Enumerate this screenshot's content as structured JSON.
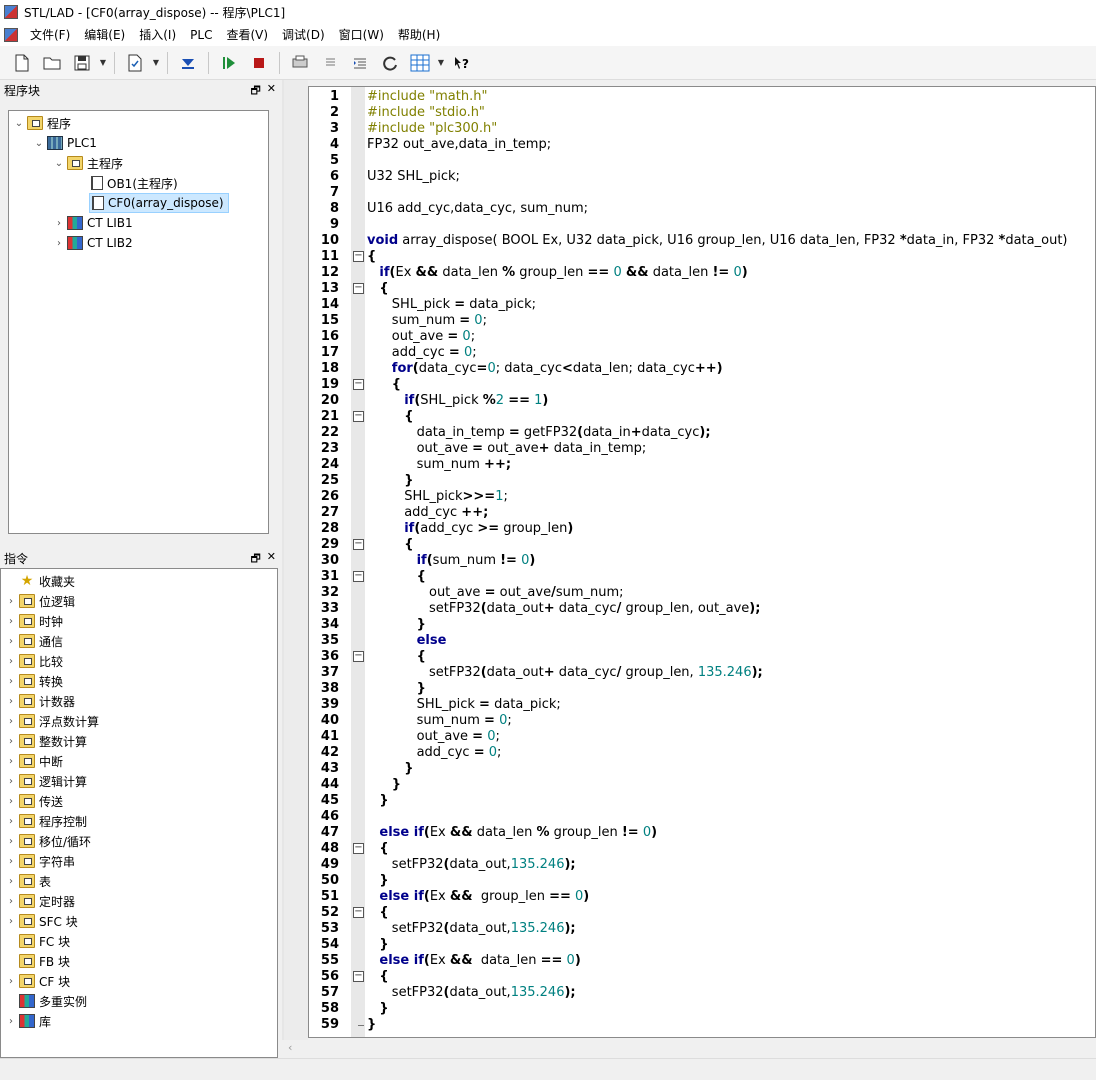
{
  "window": {
    "title": "STL/LAD - [CF0(array_dispose) -- 程序\\PLC1]"
  },
  "menu": [
    "文件(F)",
    "编辑(E)",
    "插入(I)",
    "PLC",
    "查看(V)",
    "调试(D)",
    "窗口(W)",
    "帮助(H)"
  ],
  "toolbar": {
    "icons": [
      "new-file-icon",
      "open-folder-icon",
      "save-icon",
      "save-dropdown",
      "compile-icon",
      "compile-dropdown",
      "download-icon",
      "run-icon",
      "stop-icon",
      "print-icon",
      "list-icon",
      "indent-icon",
      "refresh-icon",
      "grid-icon",
      "grid-dropdown",
      "context-help-icon"
    ]
  },
  "project_panel": {
    "title": "程序块",
    "tree": [
      {
        "label": "程序",
        "level": 0,
        "expanded": true,
        "icon": "folder-icon"
      },
      {
        "label": "PLC1",
        "level": 1,
        "expanded": true,
        "icon": "cpu-icon"
      },
      {
        "label": "主程序",
        "level": 2,
        "expanded": true,
        "icon": "folder-icon"
      },
      {
        "label": "OB1(主程序)",
        "level": 3,
        "icon": "block-icon"
      },
      {
        "label": "CF0(array_dispose)",
        "level": 3,
        "icon": "block-icon",
        "selected": true
      },
      {
        "label": "CT LIB1",
        "level": 1,
        "expanded": false,
        "icon": "library-icon"
      },
      {
        "label": "CT LIB2",
        "level": 1,
        "expanded": false,
        "icon": "library-icon"
      }
    ]
  },
  "instruction_panel": {
    "title": "指令",
    "items": [
      {
        "label": "收藏夹",
        "icon": "star-icon",
        "expandable": false
      },
      {
        "label": "位逻辑",
        "icon": "folder-icon",
        "expandable": true
      },
      {
        "label": "时钟",
        "icon": "folder-icon",
        "expandable": true
      },
      {
        "label": "通信",
        "icon": "folder-icon",
        "expandable": true
      },
      {
        "label": "比较",
        "icon": "folder-icon",
        "expandable": true
      },
      {
        "label": "转换",
        "icon": "folder-icon",
        "expandable": true
      },
      {
        "label": "计数器",
        "icon": "folder-icon",
        "expandable": true
      },
      {
        "label": "浮点数计算",
        "icon": "folder-icon",
        "expandable": true
      },
      {
        "label": "整数计算",
        "icon": "folder-icon",
        "expandable": true
      },
      {
        "label": "中断",
        "icon": "folder-icon",
        "expandable": true
      },
      {
        "label": "逻辑计算",
        "icon": "folder-icon",
        "expandable": true
      },
      {
        "label": "传送",
        "icon": "folder-icon",
        "expandable": true
      },
      {
        "label": "程序控制",
        "icon": "folder-icon",
        "expandable": true
      },
      {
        "label": "移位/循环",
        "icon": "folder-icon",
        "expandable": true
      },
      {
        "label": "字符串",
        "icon": "folder-icon",
        "expandable": true
      },
      {
        "label": "表",
        "icon": "folder-icon",
        "expandable": true
      },
      {
        "label": "定时器",
        "icon": "folder-icon",
        "expandable": true
      },
      {
        "label": "SFC 块",
        "icon": "block-folder-icon",
        "expandable": true
      },
      {
        "label": "FC 块",
        "icon": "block-folder-icon",
        "expandable": false
      },
      {
        "label": "FB 块",
        "icon": "block-folder-icon",
        "expandable": false
      },
      {
        "label": "CF 块",
        "icon": "block-folder-icon",
        "expandable": true
      },
      {
        "label": "多重实例",
        "icon": "library-icon",
        "expandable": false
      },
      {
        "label": "库",
        "icon": "library-icon",
        "expandable": true
      }
    ]
  },
  "editor": {
    "fold_markers": [
      11,
      13,
      19,
      21,
      29,
      31,
      36,
      48,
      52,
      56
    ],
    "lines": [
      [
        [
          "pp",
          "#include \"math.h\""
        ]
      ],
      [
        [
          "pp",
          "#include \"stdio.h\""
        ]
      ],
      [
        [
          "pp",
          "#include \"plc300.h\""
        ]
      ],
      [
        [
          "t",
          "FP32 out_ave,data_in_temp;"
        ]
      ],
      [
        [
          "t",
          ""
        ]
      ],
      [
        [
          "t",
          "U32 SHL_pick;"
        ]
      ],
      [
        [
          "t",
          ""
        ]
      ],
      [
        [
          "t",
          "U16 add_cyc,data_cyc, sum_num;"
        ]
      ],
      [
        [
          "t",
          ""
        ]
      ],
      [
        [
          "kw",
          "void"
        ],
        [
          "t",
          " array_dispose( BOOL Ex, U32 data_pick, U16 group_len, U16 data_len, FP32 "
        ],
        [
          "op",
          "*"
        ],
        [
          "t",
          "data_in, FP32 "
        ],
        [
          "op",
          "*"
        ],
        [
          "t",
          "data_out)"
        ]
      ],
      [
        [
          "op",
          "{"
        ]
      ],
      [
        [
          "t",
          "   "
        ],
        [
          "kw",
          "if"
        ],
        [
          "op",
          "("
        ],
        [
          "t",
          "Ex "
        ],
        [
          "op",
          "&&"
        ],
        [
          "t",
          " data_len "
        ],
        [
          "op",
          "%"
        ],
        [
          "t",
          " group_len "
        ],
        [
          "op",
          "=="
        ],
        [
          "t",
          " "
        ],
        [
          "num",
          "0"
        ],
        [
          "t",
          " "
        ],
        [
          "op",
          "&&"
        ],
        [
          "t",
          " data_len "
        ],
        [
          "op",
          "!="
        ],
        [
          "t",
          " "
        ],
        [
          "num",
          "0"
        ],
        [
          "op",
          ")"
        ]
      ],
      [
        [
          "t",
          "   "
        ],
        [
          "op",
          "{"
        ]
      ],
      [
        [
          "t",
          "      SHL_pick "
        ],
        [
          "op",
          "="
        ],
        [
          "t",
          " data_pick;"
        ]
      ],
      [
        [
          "t",
          "      sum_num "
        ],
        [
          "op",
          "="
        ],
        [
          "t",
          " "
        ],
        [
          "num",
          "0"
        ],
        [
          "t",
          ";"
        ]
      ],
      [
        [
          "t",
          "      out_ave "
        ],
        [
          "op",
          "="
        ],
        [
          "t",
          " "
        ],
        [
          "num",
          "0"
        ],
        [
          "t",
          ";"
        ]
      ],
      [
        [
          "t",
          "      add_cyc "
        ],
        [
          "op",
          "="
        ],
        [
          "t",
          " "
        ],
        [
          "num",
          "0"
        ],
        [
          "t",
          ";"
        ]
      ],
      [
        [
          "t",
          "      "
        ],
        [
          "kw",
          "for"
        ],
        [
          "op",
          "("
        ],
        [
          "t",
          "data_cyc"
        ],
        [
          "op",
          "="
        ],
        [
          "num",
          "0"
        ],
        [
          "t",
          "; data_cyc"
        ],
        [
          "op",
          "<"
        ],
        [
          "t",
          "data_len; data_cyc"
        ],
        [
          "op",
          "++)"
        ]
      ],
      [
        [
          "t",
          "      "
        ],
        [
          "op",
          "{"
        ]
      ],
      [
        [
          "t",
          "         "
        ],
        [
          "kw",
          "if"
        ],
        [
          "op",
          "("
        ],
        [
          "t",
          "SHL_pick "
        ],
        [
          "op",
          "%"
        ],
        [
          "num",
          "2"
        ],
        [
          "t",
          " "
        ],
        [
          "op",
          "=="
        ],
        [
          "t",
          " "
        ],
        [
          "num",
          "1"
        ],
        [
          "op",
          ")"
        ]
      ],
      [
        [
          "t",
          "         "
        ],
        [
          "op",
          "{"
        ]
      ],
      [
        [
          "t",
          "            data_in_temp "
        ],
        [
          "op",
          "="
        ],
        [
          "t",
          " getFP32"
        ],
        [
          "op",
          "("
        ],
        [
          "t",
          "data_in"
        ],
        [
          "op",
          "+"
        ],
        [
          "t",
          "data_cyc"
        ],
        [
          "op",
          ");"
        ]
      ],
      [
        [
          "t",
          "            out_ave "
        ],
        [
          "op",
          "="
        ],
        [
          "t",
          " out_ave"
        ],
        [
          "op",
          "+"
        ],
        [
          "t",
          " data_in_temp;"
        ]
      ],
      [
        [
          "t",
          "            sum_num "
        ],
        [
          "op",
          "++;"
        ]
      ],
      [
        [
          "t",
          "         "
        ],
        [
          "op",
          "}"
        ]
      ],
      [
        [
          "t",
          "         SHL_pick"
        ],
        [
          "op",
          ">>="
        ],
        [
          "num",
          "1"
        ],
        [
          "t",
          ";"
        ]
      ],
      [
        [
          "t",
          "         add_cyc "
        ],
        [
          "op",
          "++;"
        ]
      ],
      [
        [
          "t",
          "         "
        ],
        [
          "kw",
          "if"
        ],
        [
          "op",
          "("
        ],
        [
          "t",
          "add_cyc "
        ],
        [
          "op",
          ">="
        ],
        [
          "t",
          " group_len"
        ],
        [
          "op",
          ")"
        ]
      ],
      [
        [
          "t",
          "         "
        ],
        [
          "op",
          "{"
        ]
      ],
      [
        [
          "t",
          "            "
        ],
        [
          "kw",
          "if"
        ],
        [
          "op",
          "("
        ],
        [
          "t",
          "sum_num "
        ],
        [
          "op",
          "!="
        ],
        [
          "t",
          " "
        ],
        [
          "num",
          "0"
        ],
        [
          "op",
          ")"
        ]
      ],
      [
        [
          "t",
          "            "
        ],
        [
          "op",
          "{"
        ]
      ],
      [
        [
          "t",
          "               out_ave "
        ],
        [
          "op",
          "="
        ],
        [
          "t",
          " out_ave"
        ],
        [
          "op",
          "/"
        ],
        [
          "t",
          "sum_num;"
        ]
      ],
      [
        [
          "t",
          "               setFP32"
        ],
        [
          "op",
          "("
        ],
        [
          "t",
          "data_out"
        ],
        [
          "op",
          "+"
        ],
        [
          "t",
          " data_cyc"
        ],
        [
          "op",
          "/"
        ],
        [
          "t",
          " group_len, out_ave"
        ],
        [
          "op",
          ");"
        ]
      ],
      [
        [
          "t",
          "            "
        ],
        [
          "op",
          "}"
        ]
      ],
      [
        [
          "t",
          "            "
        ],
        [
          "kw",
          "else"
        ]
      ],
      [
        [
          "t",
          "            "
        ],
        [
          "op",
          "{"
        ]
      ],
      [
        [
          "t",
          "               setFP32"
        ],
        [
          "op",
          "("
        ],
        [
          "t",
          "data_out"
        ],
        [
          "op",
          "+"
        ],
        [
          "t",
          " data_cyc"
        ],
        [
          "op",
          "/"
        ],
        [
          "t",
          " group_len, "
        ],
        [
          "num",
          "135.246"
        ],
        [
          "op",
          ");"
        ]
      ],
      [
        [
          "t",
          "            "
        ],
        [
          "op",
          "}"
        ]
      ],
      [
        [
          "t",
          "            SHL_pick "
        ],
        [
          "op",
          "="
        ],
        [
          "t",
          " data_pick;"
        ]
      ],
      [
        [
          "t",
          "            sum_num "
        ],
        [
          "op",
          "="
        ],
        [
          "t",
          " "
        ],
        [
          "num",
          "0"
        ],
        [
          "t",
          ";"
        ]
      ],
      [
        [
          "t",
          "            out_ave "
        ],
        [
          "op",
          "="
        ],
        [
          "t",
          " "
        ],
        [
          "num",
          "0"
        ],
        [
          "t",
          ";"
        ]
      ],
      [
        [
          "t",
          "            add_cyc "
        ],
        [
          "op",
          "="
        ],
        [
          "t",
          " "
        ],
        [
          "num",
          "0"
        ],
        [
          "t",
          ";"
        ]
      ],
      [
        [
          "t",
          "         "
        ],
        [
          "op",
          "}"
        ]
      ],
      [
        [
          "t",
          "      "
        ],
        [
          "op",
          "}"
        ]
      ],
      [
        [
          "t",
          "   "
        ],
        [
          "op",
          "}"
        ]
      ],
      [
        [
          "t",
          ""
        ]
      ],
      [
        [
          "t",
          "   "
        ],
        [
          "kw",
          "else if"
        ],
        [
          "op",
          "("
        ],
        [
          "t",
          "Ex "
        ],
        [
          "op",
          "&&"
        ],
        [
          "t",
          " data_len "
        ],
        [
          "op",
          "%"
        ],
        [
          "t",
          " group_len "
        ],
        [
          "op",
          "!="
        ],
        [
          "t",
          " "
        ],
        [
          "num",
          "0"
        ],
        [
          "op",
          ")"
        ]
      ],
      [
        [
          "t",
          "   "
        ],
        [
          "op",
          "{"
        ]
      ],
      [
        [
          "t",
          "      setFP32"
        ],
        [
          "op",
          "("
        ],
        [
          "t",
          "data_out,"
        ],
        [
          "num",
          "135.246"
        ],
        [
          "op",
          ");"
        ]
      ],
      [
        [
          "t",
          "   "
        ],
        [
          "op",
          "}"
        ]
      ],
      [
        [
          "t",
          "   "
        ],
        [
          "kw",
          "else if"
        ],
        [
          "op",
          "("
        ],
        [
          "t",
          "Ex "
        ],
        [
          "op",
          "&&"
        ],
        [
          "t",
          "  group_len "
        ],
        [
          "op",
          "=="
        ],
        [
          "t",
          " "
        ],
        [
          "num",
          "0"
        ],
        [
          "op",
          ")"
        ]
      ],
      [
        [
          "t",
          "   "
        ],
        [
          "op",
          "{"
        ]
      ],
      [
        [
          "t",
          "      setFP32"
        ],
        [
          "op",
          "("
        ],
        [
          "t",
          "data_out,"
        ],
        [
          "num",
          "135.246"
        ],
        [
          "op",
          ");"
        ]
      ],
      [
        [
          "t",
          "   "
        ],
        [
          "op",
          "}"
        ]
      ],
      [
        [
          "t",
          "   "
        ],
        [
          "kw",
          "else if"
        ],
        [
          "op",
          "("
        ],
        [
          "t",
          "Ex "
        ],
        [
          "op",
          "&&"
        ],
        [
          "t",
          "  data_len "
        ],
        [
          "op",
          "=="
        ],
        [
          "t",
          " "
        ],
        [
          "num",
          "0"
        ],
        [
          "op",
          ")"
        ]
      ],
      [
        [
          "t",
          "   "
        ],
        [
          "op",
          "{"
        ]
      ],
      [
        [
          "t",
          "      setFP32"
        ],
        [
          "op",
          "("
        ],
        [
          "t",
          "data_out,"
        ],
        [
          "num",
          "135.246"
        ],
        [
          "op",
          ");"
        ]
      ],
      [
        [
          "t",
          "   "
        ],
        [
          "op",
          "}"
        ]
      ],
      [
        [
          "op",
          "}"
        ]
      ]
    ]
  },
  "colors": {
    "keyword": "#00008b",
    "preprocessor": "#808000",
    "number": "#008080",
    "selection": "#cce8ff"
  }
}
